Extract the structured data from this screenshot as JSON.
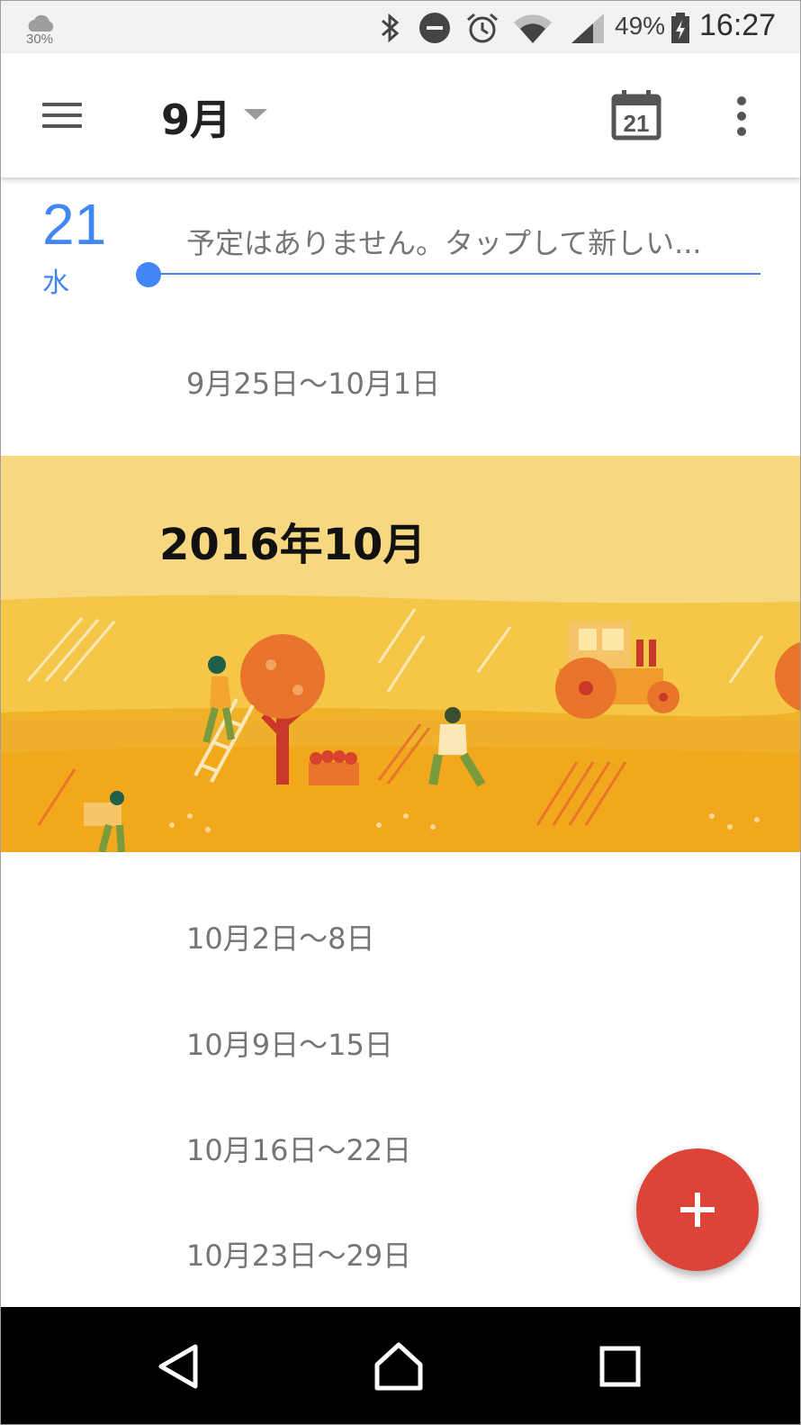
{
  "status_bar": {
    "weather_percent": "30%",
    "battery_percent": "49%",
    "time": "16:27",
    "icons": [
      "cloud-icon",
      "bluetooth-icon",
      "do-not-disturb-icon",
      "alarm-icon",
      "wifi-icon",
      "signal-icon",
      "battery-charging-icon"
    ]
  },
  "app_bar": {
    "month": "9月",
    "today_date": "21",
    "icons": [
      "menu-icon",
      "dropdown-arrow-icon",
      "calendar-today-icon",
      "more-vert-icon"
    ]
  },
  "day": {
    "number": "21",
    "weekday": "水",
    "no_events_text": "予定はありません。タップして新しい..."
  },
  "weeks_before": [
    "9月25日〜10月1日"
  ],
  "month_banner": {
    "title": "2016年10月",
    "colors": {
      "sky": "#f7d77f",
      "field": "#f1b21f",
      "accent": "#e8772e"
    }
  },
  "weeks_after": [
    "10月2日〜8日",
    "10月9日〜15日",
    "10月16日〜22日",
    "10月23日〜29日"
  ],
  "fab": {
    "icon": "plus-icon",
    "color": "#db4437"
  },
  "nav_bar": {
    "icons": [
      "back-icon",
      "home-icon",
      "recents-icon"
    ]
  },
  "accent_color": "#4285f4"
}
